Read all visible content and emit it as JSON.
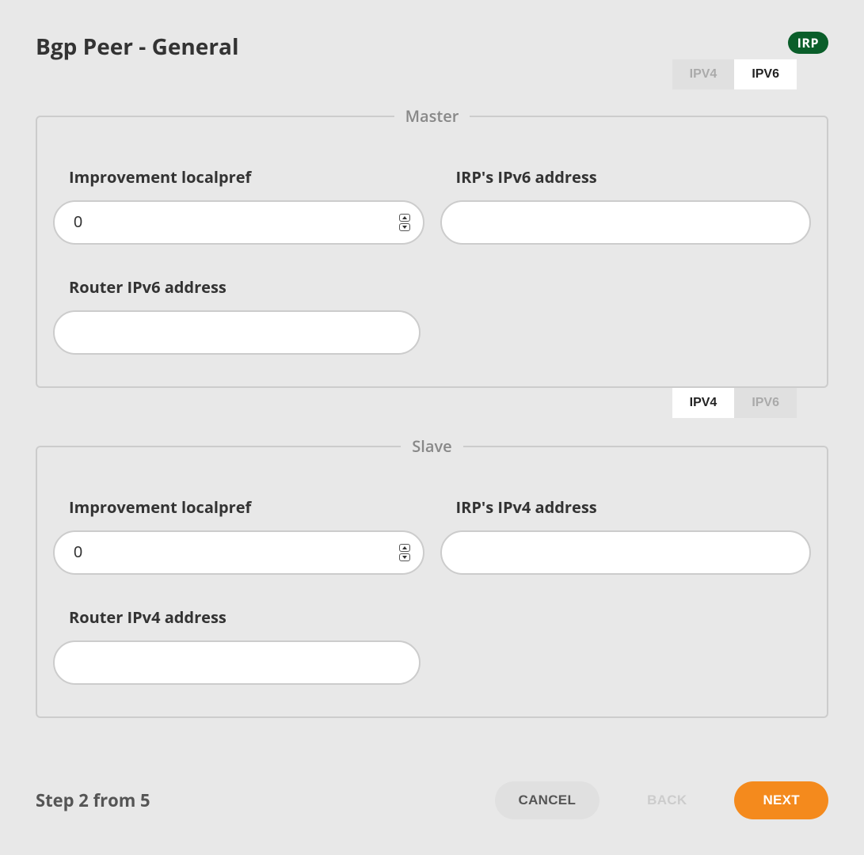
{
  "header": {
    "title": "Bgp Peer - General",
    "badge": "IRP"
  },
  "tabs_top": {
    "ipv4": "IPV4",
    "ipv6": "IPV6"
  },
  "tabs_mid": {
    "ipv4": "IPV4",
    "ipv6": "IPV6"
  },
  "master": {
    "legend": "Master",
    "localpref_label": "Improvement localpref",
    "localpref_value": "0",
    "irp_address_label": "IRP's IPv6 address",
    "irp_address_value": "",
    "router_address_label": "Router IPv6 address",
    "router_address_value": ""
  },
  "slave": {
    "legend": "Slave",
    "localpref_label": "Improvement localpref",
    "localpref_value": "0",
    "irp_address_label": "IRP's IPv4 address",
    "irp_address_value": "",
    "router_address_label": "Router IPv4 address",
    "router_address_value": ""
  },
  "footer": {
    "step_text": "Step 2 from 5",
    "cancel": "CANCEL",
    "back": "BACK",
    "next": "NEXT"
  }
}
